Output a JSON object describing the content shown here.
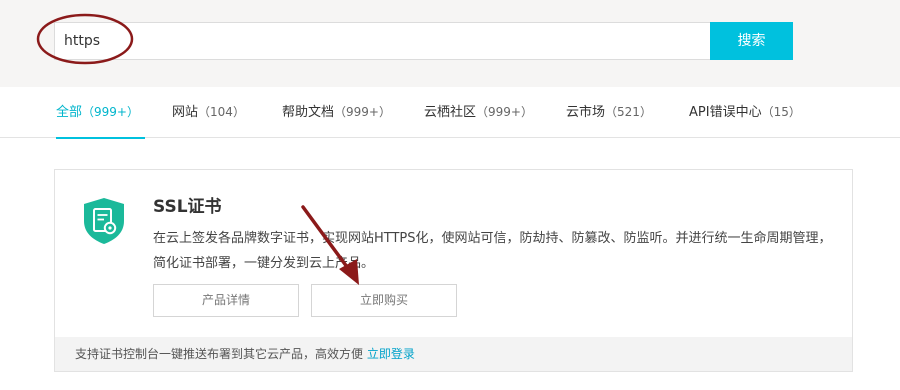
{
  "search": {
    "value": "https",
    "button_label": "搜索"
  },
  "tabs": [
    {
      "label": "全部",
      "open": "（",
      "count": "999+",
      "close": "）"
    },
    {
      "label": "网站",
      "open": "（",
      "count": "104",
      "close": "）"
    },
    {
      "label": "帮助文档",
      "open": "（",
      "count": "999+",
      "close": "）"
    },
    {
      "label": "云栖社区",
      "open": "（",
      "count": "999+",
      "close": "）"
    },
    {
      "label": "云市场",
      "open": "（",
      "count": "521",
      "close": "）"
    },
    {
      "label": "API错误中心",
      "open": "（",
      "count": "15",
      "close": "）"
    }
  ],
  "result": {
    "icon": "ssl-certificate-shield-icon",
    "title": "SSL证书",
    "description": "在云上签发各品牌数字证书，实现网站HTTPS化，使网站可信，防劫持、防篡改、防监听。并进行统一生命周期管理，简化证书部署，一键分发到云上产品。",
    "details_button": "产品详情",
    "buy_button": "立即购买",
    "footer_text": "支持证书控制台一键推送布署到其它云产品，高效方便",
    "footer_link": "立即登录"
  },
  "colors": {
    "accent": "#00c1de",
    "annotation": "#8b1a1a"
  }
}
